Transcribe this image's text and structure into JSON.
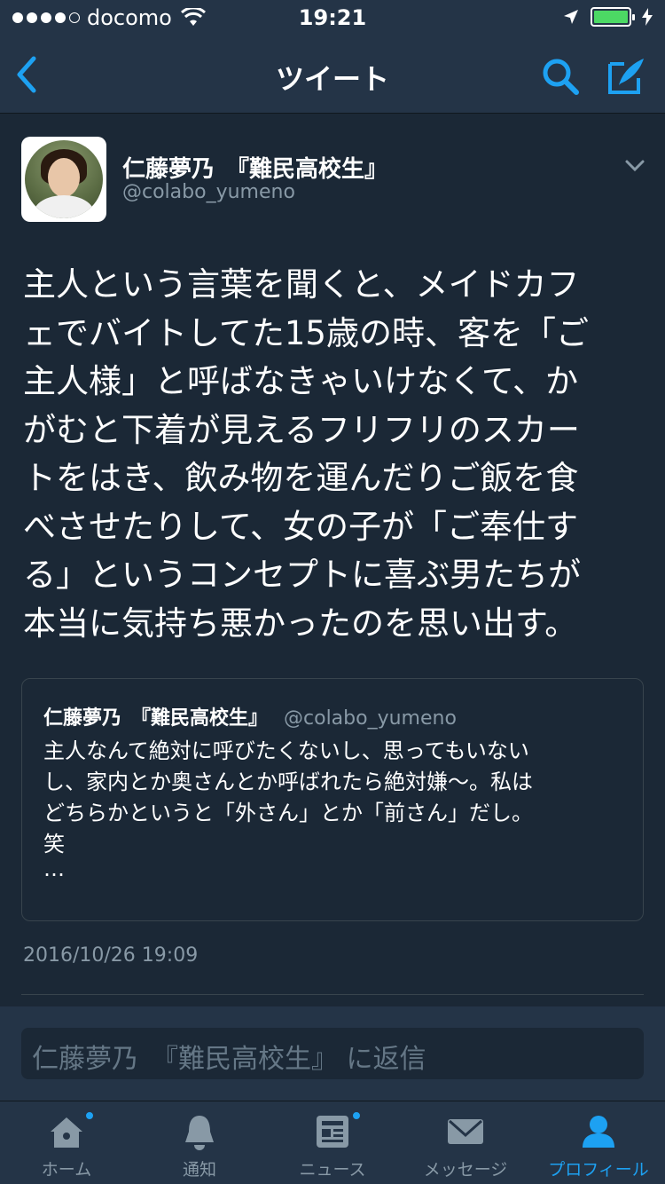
{
  "status_bar": {
    "carrier": "docomo",
    "time": "19:21",
    "battery_color": "#4cd964"
  },
  "nav": {
    "title": "ツイート",
    "back_icon": "chevron-left-icon",
    "search_icon": "search-icon",
    "compose_icon": "compose-icon"
  },
  "tweet": {
    "display_name": "仁藤夢乃　『難民高校生』",
    "handle": "@colabo_yumeno",
    "text_lines": [
      "主人という言葉を聞くと、メイドカフ",
      "ェでバイトしてた15歳の時、客を「ご",
      "主人様」と呼ばなきゃいけなくて、か",
      "がむと下着が見えるフリフリのスカー",
      "トをはき、飲み物を運んだりご飯を食",
      "べさせたりして、女の子が「ご奉仕す",
      "る」というコンセプトに喜ぶ男たちが",
      "本当に気持ち悪かったのを思い出す。"
    ],
    "timestamp": "2016/10/26 19:09"
  },
  "quoted_tweet": {
    "display_name": "仁藤夢乃　『難民高校生』",
    "handle": "@colabo_yumeno",
    "text_lines": [
      "主人なんて絶対に呼びたくないし、思ってもいない",
      "し、家内とか奥さんとか呼ばれたら絶対嫌〜。私は",
      "どちらかというと「外さん」とか「前さん」だし。",
      "笑"
    ],
    "more": "…"
  },
  "reply": {
    "placeholder": "仁藤夢乃　『難民高校生』 に返信"
  },
  "tabbar": {
    "tabs": [
      {
        "label": "ホーム",
        "icon": "home-icon",
        "badge": true
      },
      {
        "label": "通知",
        "icon": "bell-icon",
        "badge": false
      },
      {
        "label": "ニュース",
        "icon": "news-icon",
        "badge": true
      },
      {
        "label": "メッセージ",
        "icon": "mail-icon",
        "badge": false
      },
      {
        "label": "プロフィール",
        "icon": "profile-icon",
        "badge": false,
        "active": true
      }
    ]
  },
  "colors": {
    "background": "#1b2836",
    "bar": "#243447",
    "accent": "#1da1f2",
    "muted": "#8899a6"
  }
}
